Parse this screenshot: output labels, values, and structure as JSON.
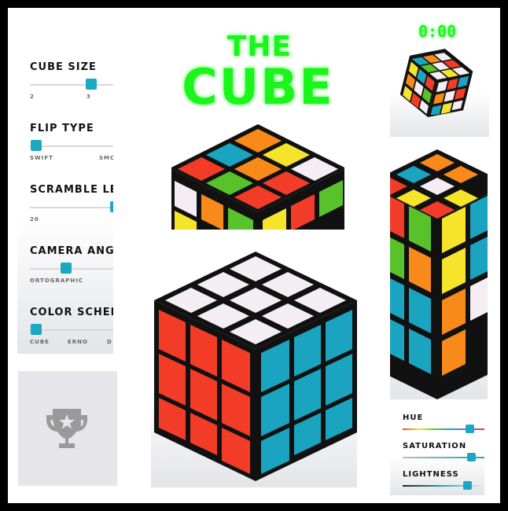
{
  "title": {
    "line1": "THE",
    "line2": "CUBE"
  },
  "timer": "0:00",
  "settings": [
    {
      "label": "CUBE SIZE",
      "ticks": [
        "2",
        "3"
      ],
      "value_index": 1
    },
    {
      "label": "FLIP TYPE",
      "ticks": [
        "SWIFT",
        "SMO"
      ],
      "value_index": 0
    },
    {
      "label": "SCRAMBLE LE",
      "ticks": [
        "20"
      ],
      "value_fraction": 0.98
    },
    {
      "label": "CAMERA ANGL",
      "ticks": [
        "ORTOGRAPHIC"
      ],
      "value_fraction": 0.38
    },
    {
      "label": "COLOR SCHEM",
      "ticks": [
        "CUBE",
        "ERNO",
        "D"
      ],
      "value_index": 0
    }
  ],
  "color_sliders": [
    {
      "label": "HUE",
      "value_fraction": 0.84
    },
    {
      "label": "SATURATION",
      "value_fraction": 0.86
    },
    {
      "label": "LIGHTNESS",
      "value_fraction": 0.81
    }
  ],
  "achievements": {
    "icon": "trophy-icon"
  },
  "colors": {
    "accent_green": "#1cf51c",
    "knob": "#1aa8c2",
    "red": "#f23c27",
    "blue": "#1aa4c0",
    "white": "#f4eef4",
    "orange": "#f88a1a",
    "yellow": "#f6e42a",
    "green": "#59c12a"
  }
}
